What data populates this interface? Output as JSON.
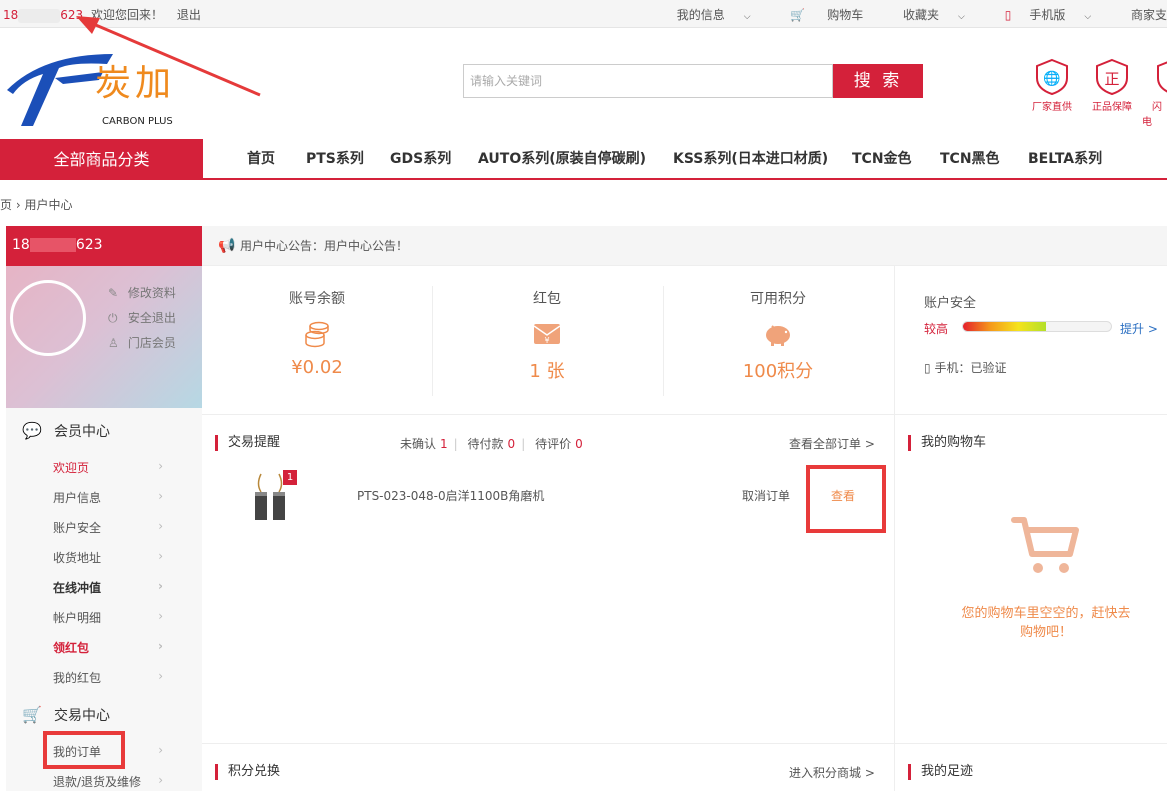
{
  "topbar": {
    "user_prefix": "18",
    "user_suffix": "623",
    "welcome": "欢迎您回来！",
    "logout": "退出",
    "links": [
      {
        "label": "我的信息",
        "caret": true
      },
      {
        "label": "购物车",
        "caret": false
      },
      {
        "label": "收藏夹",
        "caret": true
      },
      {
        "label": "手机版",
        "caret": true
      },
      {
        "label": "商家支",
        "caret": false
      }
    ]
  },
  "header": {
    "logo_cn": "炭加",
    "logo_en": "CARBON PLUS",
    "search_placeholder": "请输入关键词",
    "search_button": "搜 索",
    "badges": [
      "厂家直供",
      "正品保障",
      "闪电"
    ],
    "badge_glyphs": [
      "🌐",
      "正",
      ""
    ]
  },
  "nav": {
    "all_categories": "全部商品分类",
    "items": [
      "首页",
      "PTS系列",
      "GDS系列",
      "AUTO系列(原装自停碳刷)",
      "KSS系列(日本进口材质)",
      "TCN金色",
      "TCN黑色",
      "BELTA系列"
    ]
  },
  "breadcrumb": {
    "home": "页",
    "sep": "›",
    "current": "用户中心"
  },
  "sidebar": {
    "user_prefix": "18",
    "user_suffix": "623",
    "links": [
      "修改资料",
      "安全退出",
      "门店会员"
    ],
    "member_center": "会员中心",
    "member_items": [
      "欢迎页",
      "用户信息",
      "账户安全",
      "收货地址",
      "在线冲值",
      "帐户明细",
      "领红包",
      "我的红包"
    ],
    "trade_center": "交易中心",
    "trade_items": [
      "我的订单",
      "退款/退货及维修"
    ]
  },
  "notice": "用户中心公告：用户中心公告！",
  "stats": [
    {
      "label": "账号余额",
      "value": "¥0.02",
      "icon": "coins-icon"
    },
    {
      "label": "红包",
      "value": "1 张",
      "icon": "red-envelope-icon"
    },
    {
      "label": "可用积分",
      "value": "100积分",
      "icon": "piggy-bank-icon"
    }
  ],
  "security": {
    "title": "账户安全",
    "level": "较高",
    "level_fraction": 0.56,
    "upgrade": "提升 >",
    "phone": "手机：已验证"
  },
  "trade": {
    "title": "交易提醒",
    "unconfirmed_label": "未确认",
    "unconfirmed": "1",
    "unpaid_label": "待付款",
    "unpaid": "0",
    "unrated_label": "待评价",
    "unrated": "0",
    "view_all": "查看全部订单 >",
    "order": {
      "qty": "1",
      "name": "PTS-023-048-0启洋1100B角磨机",
      "cancel": "取消订单",
      "view": "查看"
    }
  },
  "cart": {
    "title": "我的购物车",
    "empty_line1": "您的购物车里空空的，赶快去",
    "empty_line2": "购物吧！"
  },
  "points": {
    "title": "积分兑换",
    "enter": "进入积分商城 >"
  },
  "footprint": {
    "title": "我的足迹"
  },
  "colors": {
    "brand_red": "#d4213a",
    "accent_orange": "#ef8a4a",
    "link_blue": "#2b6fc2"
  }
}
